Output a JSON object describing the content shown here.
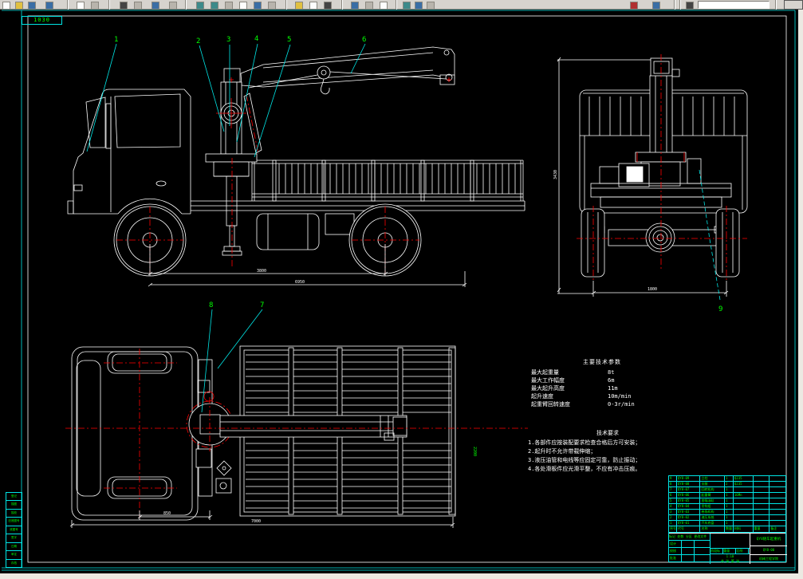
{
  "toolbar": {
    "combo_value": ""
  },
  "sheet": {
    "zone_label": "1030",
    "border_color": "#00e5e5",
    "line_color": "#ffffff",
    "label_color": "#00ff00",
    "centerline_color": "#ff0000"
  },
  "labels": {
    "side": [
      "1",
      "2",
      "3",
      "4",
      "5",
      "6"
    ],
    "top": [
      "8",
      "7"
    ],
    "rear": [
      "9"
    ]
  },
  "dims": {
    "side_wheelbase": "3800",
    "side_overall": "6950",
    "rear_height": "3430",
    "rear_track": "1800",
    "top_cab": "850",
    "top_overall": "7000",
    "top_width": "2200"
  },
  "parameters": {
    "title": "主要技术参数",
    "rows": [
      {
        "label": "最大起重量",
        "value": "8t"
      },
      {
        "label": "最大工作幅度",
        "value": "6m"
      },
      {
        "label": "最大起升高度",
        "value": "11m"
      },
      {
        "label": "起升速度",
        "value": "10m/min"
      },
      {
        "label": "起重臂回转速度",
        "value": "0-3r/min"
      }
    ]
  },
  "requirements": {
    "title": "技术要求",
    "items": [
      "1.各部件应按装配要求检查合格后方可安装；",
      "2.起升时不允许带载伸缩；",
      "3.液压油管和电线等应固定可靠，防止振动；",
      "4.各处滑板件应光滑平整，不应有冲击压痕。"
    ]
  },
  "bom": {
    "headers": [
      "序号",
      "代号",
      "名称",
      "数量",
      "材料",
      "重量",
      "备注"
    ],
    "rows": [
      {
        "no": "9",
        "code": "QY8-09",
        "name": "立柱",
        "qty": "1",
        "material": "Q235"
      },
      {
        "no": "8",
        "code": "QY8-08",
        "name": "支腿",
        "qty": "2",
        "material": "Q235"
      },
      {
        "no": "7",
        "code": "QY8-07",
        "name": "回转机构",
        "qty": "1",
        "material": ""
      },
      {
        "no": "6",
        "code": "QY8-06",
        "name": "起重臂",
        "qty": "1",
        "material": "16Mn"
      },
      {
        "no": "5",
        "code": "QY8-05",
        "name": "变幅油缸",
        "qty": "1",
        "material": ""
      },
      {
        "no": "4",
        "code": "QY8-04",
        "name": "吊钩组",
        "qty": "1",
        "material": ""
      },
      {
        "no": "3",
        "code": "QY8-03",
        "name": "卷扬机构",
        "qty": "1",
        "material": ""
      },
      {
        "no": "2",
        "code": "QY8-02",
        "name": "液压系统",
        "qty": "1",
        "material": ""
      },
      {
        "no": "1",
        "code": "QY8-01",
        "name": "汽车底盘",
        "qty": "1",
        "material": ""
      }
    ]
  },
  "title_block": {
    "left_rows": [
      "标记 处数 分区 更改文件号 签名 年月日",
      "设计",
      "校核",
      "批准"
    ],
    "stage_labels": [
      "阶段标记",
      "重量",
      "比例"
    ],
    "scale": "1:10",
    "sheet_note": "共 张 第 张",
    "product_name": "QY8随车起重机",
    "drawing_no": "QY8-00",
    "org": "机械工程学院"
  },
  "zone_table": {
    "rows": [
      "登记",
      "描图",
      "描校",
      "旧底图号",
      "底图号",
      "签字",
      "日期",
      "审定",
      "存档"
    ]
  }
}
